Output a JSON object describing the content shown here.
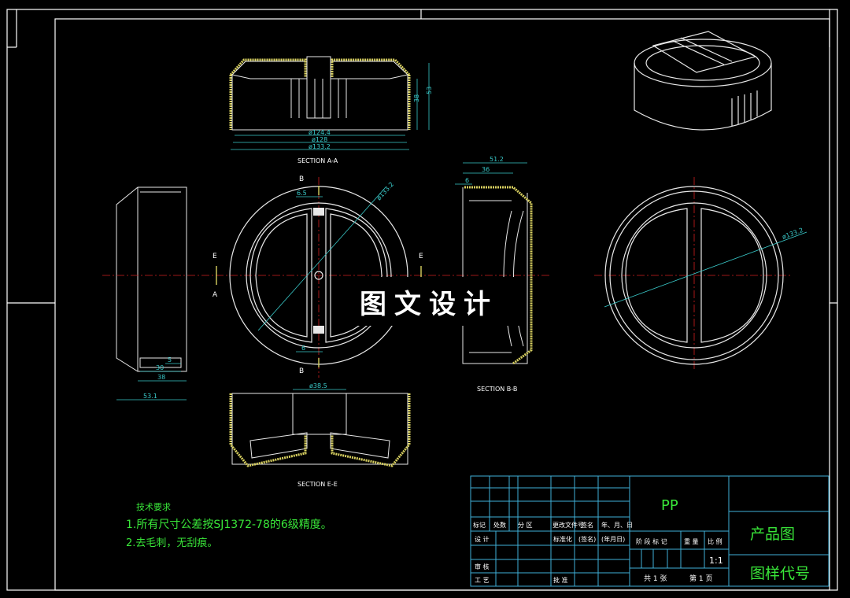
{
  "colors": {
    "background": "#000000",
    "frame": "#ffffff",
    "outline": "#e8e8e8",
    "section_hatch": "#d8d060",
    "dimension": "#39c9c9",
    "centerline": "#d02020",
    "table": "#3fb0d8",
    "text_green": "#39e639",
    "text_white": "#ffffff"
  },
  "views": {
    "section_aa": {
      "label": "SECTION A-A",
      "dims": [
        "ø124.4",
        "ø128",
        "ø133.2",
        "38",
        "53"
      ]
    },
    "section_bb": {
      "label": "SECTION B-B",
      "dims": [
        "51.2",
        "36",
        "6"
      ]
    },
    "section_ee": {
      "label": "SECTION E-E",
      "dims": [
        "ø38.5"
      ]
    },
    "front_view": {
      "dims": [
        "6.5",
        "6",
        "ø133.2"
      ],
      "markers": [
        "B",
        "B",
        "E",
        "E",
        "A",
        "A"
      ]
    },
    "right_view": {
      "dims": [
        "ø133.2"
      ]
    },
    "side_view": {
      "dims": [
        "5",
        "30",
        "38",
        "53.1"
      ]
    }
  },
  "watermark": "图文设计",
  "tech_requirements": {
    "title": "技术要求",
    "items": [
      "1.所有尺寸公差按SJ1372-78的6级精度。",
      "2.去毛刺，无刮痕。"
    ]
  },
  "title_block": {
    "material": "PP",
    "title": "产品图",
    "drawing_code": "图样代号",
    "scale": "1:1",
    "header_row": [
      "标记",
      "处数",
      "分 区",
      "更改文件号",
      "签名",
      "年、月、日"
    ],
    "row_design": [
      "设 计",
      "",
      "标准化",
      "(签名)",
      "(年月日)"
    ],
    "stage_labels": [
      "阶 段 标 记",
      "重 量",
      "比 例"
    ],
    "row_review": "审 核",
    "row_process": "工 艺",
    "approve": "批 准",
    "sheets": "共 1 张",
    "sheet_no": "第 1 页"
  }
}
